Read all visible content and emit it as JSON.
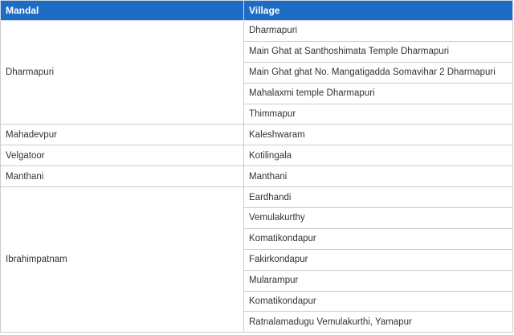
{
  "table": {
    "headers": [
      "Mandal",
      "Village"
    ],
    "groups": [
      {
        "mandal": "Dharmapuri",
        "villages": [
          "Dharmapuri",
          "Main Ghat at Santhoshimata Temple Dharmapuri",
          "Main Ghat ghat No. Mangatigadda Somavihar 2 Dharmapuri",
          "Mahalaxmi temple Dharmapuri",
          "Thimmapur"
        ]
      },
      {
        "mandal": "Mahadevpur",
        "villages": [
          "Kaleshwaram"
        ]
      },
      {
        "mandal": "Velgatoor",
        "villages": [
          "Kotilingala"
        ]
      },
      {
        "mandal": "Manthani",
        "villages": [
          "Manthani"
        ]
      },
      {
        "mandal": "Ibrahimpatnam",
        "villages": [
          "Eardhandi",
          "Vemulakurthy",
          "Komatikondapur",
          "Fakirkondapur",
          "Mularampur",
          "Komatikondapur",
          "Ratnalamadugu Vemulakurthi, Yamapur"
        ]
      }
    ]
  }
}
